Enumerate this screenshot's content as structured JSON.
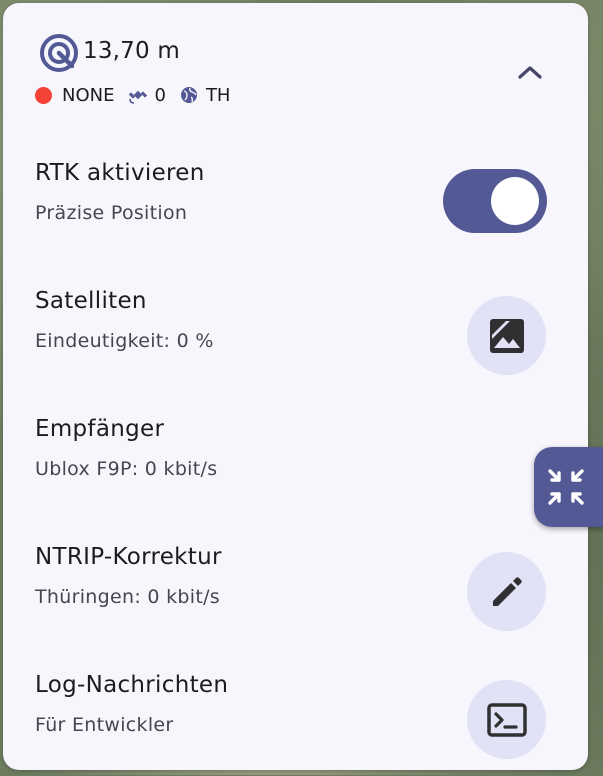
{
  "header": {
    "accuracy_icon": "gps-target-icon",
    "accuracy_value": "13,70 m",
    "fix_status": "NONE",
    "fix_status_color": "#f44336",
    "satellite_icon": "satellite-icon",
    "satellite_count": "0",
    "region_icon": "globe-icon",
    "region_code": "TH",
    "collapse_icon": "chevron-up-icon"
  },
  "rows": [
    {
      "title": "RTK aktivieren",
      "subtitle": "Präzise Position",
      "control": "toggle",
      "toggle_on": true
    },
    {
      "title": "Satelliten",
      "subtitle": "Eindeutigkeit: 0 %",
      "control": "button",
      "icon": "image-icon"
    },
    {
      "title": "Empfänger",
      "subtitle": "Ublox F9P: 0 kbit/s",
      "control": "none"
    },
    {
      "title": "NTRIP-Korrektur",
      "subtitle": "Thüringen: 0 kbit/s",
      "control": "button",
      "icon": "edit-pencil-icon"
    },
    {
      "title": "Log-Nachrichten",
      "subtitle": "Für Entwickler",
      "control": "button",
      "icon": "terminal-icon"
    }
  ],
  "fab": {
    "icon": "collapse-arrows-icon"
  },
  "colors": {
    "accent": "#535994",
    "button_bg": "#e2e2f6",
    "panel_bg": "#f8f6fd",
    "icon_dark": "#303033"
  }
}
